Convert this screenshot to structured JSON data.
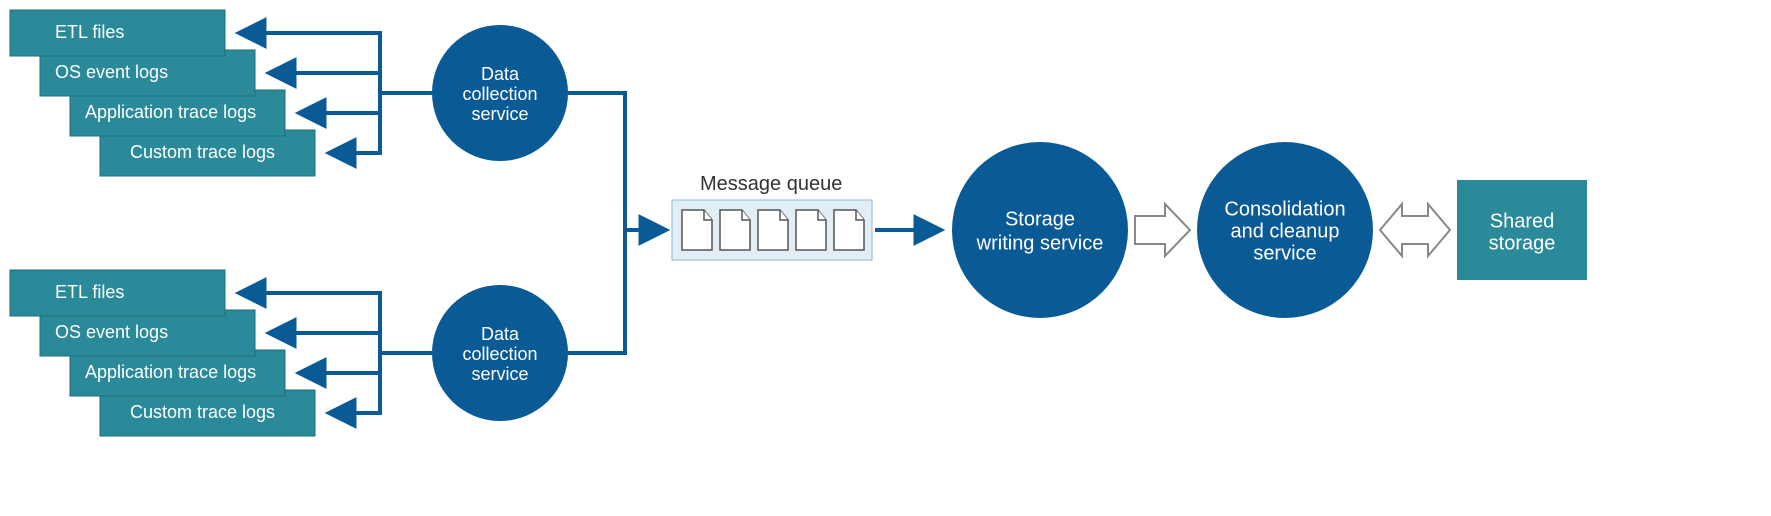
{
  "diagram": {
    "source_group_a": {
      "items": [
        "ETL files",
        "OS event logs",
        "Application trace logs",
        "Custom trace logs"
      ]
    },
    "source_group_b": {
      "items": [
        "ETL files",
        "OS event logs",
        "Application trace logs",
        "Custom trace logs"
      ]
    },
    "collector_a": {
      "line1": "Data",
      "line2": "collection",
      "line3": "service"
    },
    "collector_b": {
      "line1": "Data",
      "line2": "collection",
      "line3": "service"
    },
    "queue_label": "Message queue",
    "storage_writing": {
      "line1": "Storage",
      "line2": "writing service"
    },
    "consolidation": {
      "line1": "Consolidation",
      "line2": "and cleanup",
      "line3": "service"
    },
    "shared_storage": {
      "line1": "Shared",
      "line2": "storage"
    },
    "colors": {
      "teal": "#2a8a9a",
      "blue": "#0a5a96",
      "queue_bg": "#e1eef5"
    }
  }
}
